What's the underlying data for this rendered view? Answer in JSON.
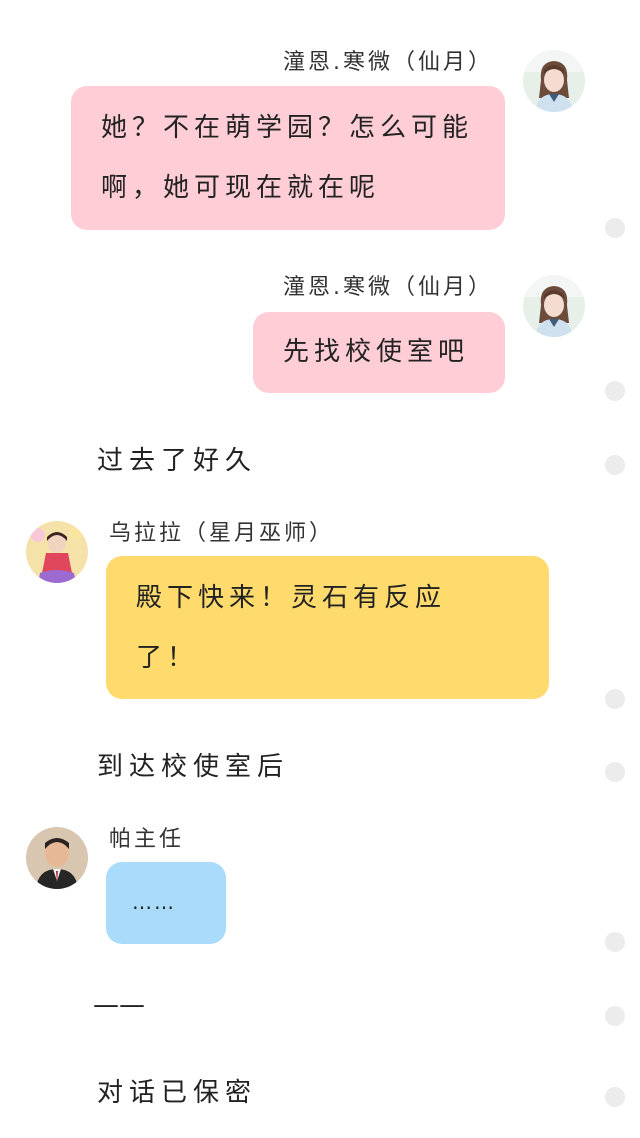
{
  "messages": [
    {
      "speaker": "潼恩.寒微（仙月）",
      "text": "她？不在萌学园？怎么可能啊，她可现在就在呢",
      "bubble_color": "#ffcdd6",
      "side": "right",
      "avatar_icon": "girl-avatar-icon"
    },
    {
      "speaker": "潼恩.寒微（仙月）",
      "text": "先找校使室吧",
      "bubble_color": "#ffcdd6",
      "side": "right",
      "avatar_icon": "girl-avatar-icon"
    },
    {
      "speaker": "乌拉拉（星月巫师）",
      "text": "殿下快来！灵石有反应了！",
      "bubble_color": "#ffdb6e",
      "side": "left",
      "avatar_icon": "ulala-avatar-icon"
    },
    {
      "speaker": "帕主任",
      "text": "……",
      "bubble_color": "#a9dcfa",
      "side": "left",
      "avatar_icon": "man-avatar-icon"
    }
  ],
  "narration": {
    "time_passed": "过去了好久",
    "arrived": "到达校使室后",
    "dash": "——",
    "sealed": "对话已保密"
  }
}
